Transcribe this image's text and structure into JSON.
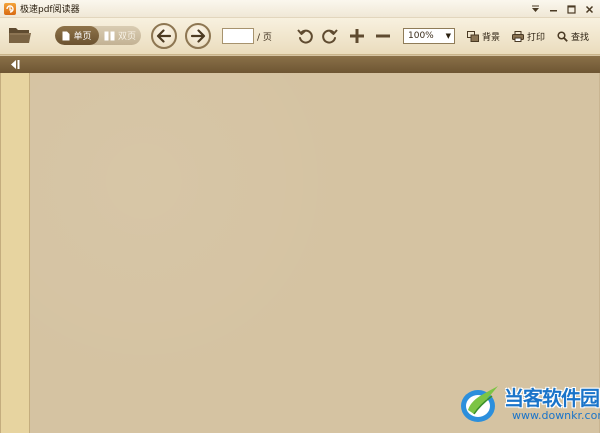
{
  "window": {
    "title": "极速pdf阅读器",
    "controls": {
      "menu_icon": "menu-triangle-icon",
      "minimize_icon": "minimize-icon",
      "maximize_icon": "maximize-icon",
      "close_icon": "close-icon"
    }
  },
  "toolbar": {
    "open_icon": "folder-icon",
    "single_page_label": "单页",
    "double_page_label": "双页",
    "prev_icon": "arrow-left-icon",
    "next_icon": "arrow-right-icon",
    "page_input_value": "",
    "page_separator": "/ 页",
    "rotate_left_icon": "rotate-left-icon",
    "rotate_right_icon": "rotate-right-icon",
    "zoom_in_icon": "plus-icon",
    "zoom_out_icon": "minus-icon",
    "zoom_value": "100%",
    "background_label": "背景",
    "print_label": "打印",
    "find_label": "查找"
  },
  "sidebar": {
    "collapse_icon": "collapse-sidebar-icon"
  },
  "watermark": {
    "title": "当客软件园",
    "url": "www.downkr.com"
  },
  "colors": {
    "toolbar_bg": "#eadcbd",
    "accent_brown": "#7a6039",
    "doc_bg": "#d5c3a2",
    "sidebar_bg": "#e7d4a0",
    "watermark_blue": "#1a74c9"
  }
}
